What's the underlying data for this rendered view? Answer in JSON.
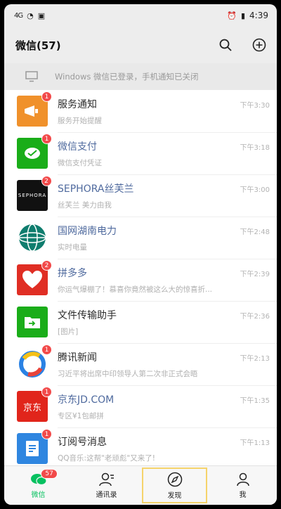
{
  "status_bar": {
    "signal": "4G",
    "battery": "▮",
    "time": "4:39"
  },
  "header": {
    "title": "微信(57)"
  },
  "notice": {
    "text": "Windows 微信已登录，手机通知已关闭"
  },
  "chats": [
    {
      "name": "服务通知",
      "preview": "服务开始提醒",
      "time": "下午3:30",
      "badge": "1",
      "color": "#f0912b",
      "glyph": "📢"
    },
    {
      "name": "微信支付",
      "preview": "微信支付凭证",
      "time": "下午3:18",
      "badge": "1",
      "color": "#1aad19",
      "glyph": "✓"
    },
    {
      "name": "SEPHORA丝芙兰",
      "preview": "丝芙兰 美力由我",
      "time": "下午3:00",
      "badge": "2",
      "color": "#111111",
      "glyph": "SEPHORA"
    },
    {
      "name": "国网湖南电力",
      "preview": "实时电量",
      "time": "下午2:48",
      "badge": "",
      "color": "#0f7d6e",
      "glyph": "◎"
    },
    {
      "name": "拼多多",
      "preview": "你运气爆棚了！慕喜你竟然被这么大的惊喜折...",
      "time": "下午2:39",
      "badge": "2",
      "color": "#e02e24",
      "glyph": "❤"
    },
    {
      "name": "文件传输助手",
      "preview": "[图片]",
      "time": "下午2:36",
      "badge": "",
      "color": "#1aad19",
      "glyph": "➜"
    },
    {
      "name": "腾讯新闻",
      "preview": "习近平将出席中印领导人第二次非正式会晤",
      "time": "下午2:13",
      "badge": "1",
      "color": "#ffffff",
      "glyph": "◕"
    },
    {
      "name": "京东JD.COM",
      "preview": "专区¥1包邮拼",
      "time": "下午1:35",
      "badge": "1",
      "color": "#e1251b",
      "glyph": "京东"
    },
    {
      "name": "订阅号消息",
      "preview": "QQ音乐:这帮\"老顽彪\"又来了!",
      "time": "下午1:13",
      "badge": "1",
      "color": "#2f86e0",
      "glyph": "≡"
    }
  ],
  "tabs": [
    {
      "label": "微信",
      "badge": "57"
    },
    {
      "label": "通讯录"
    },
    {
      "label": "发现"
    },
    {
      "label": "我"
    }
  ]
}
